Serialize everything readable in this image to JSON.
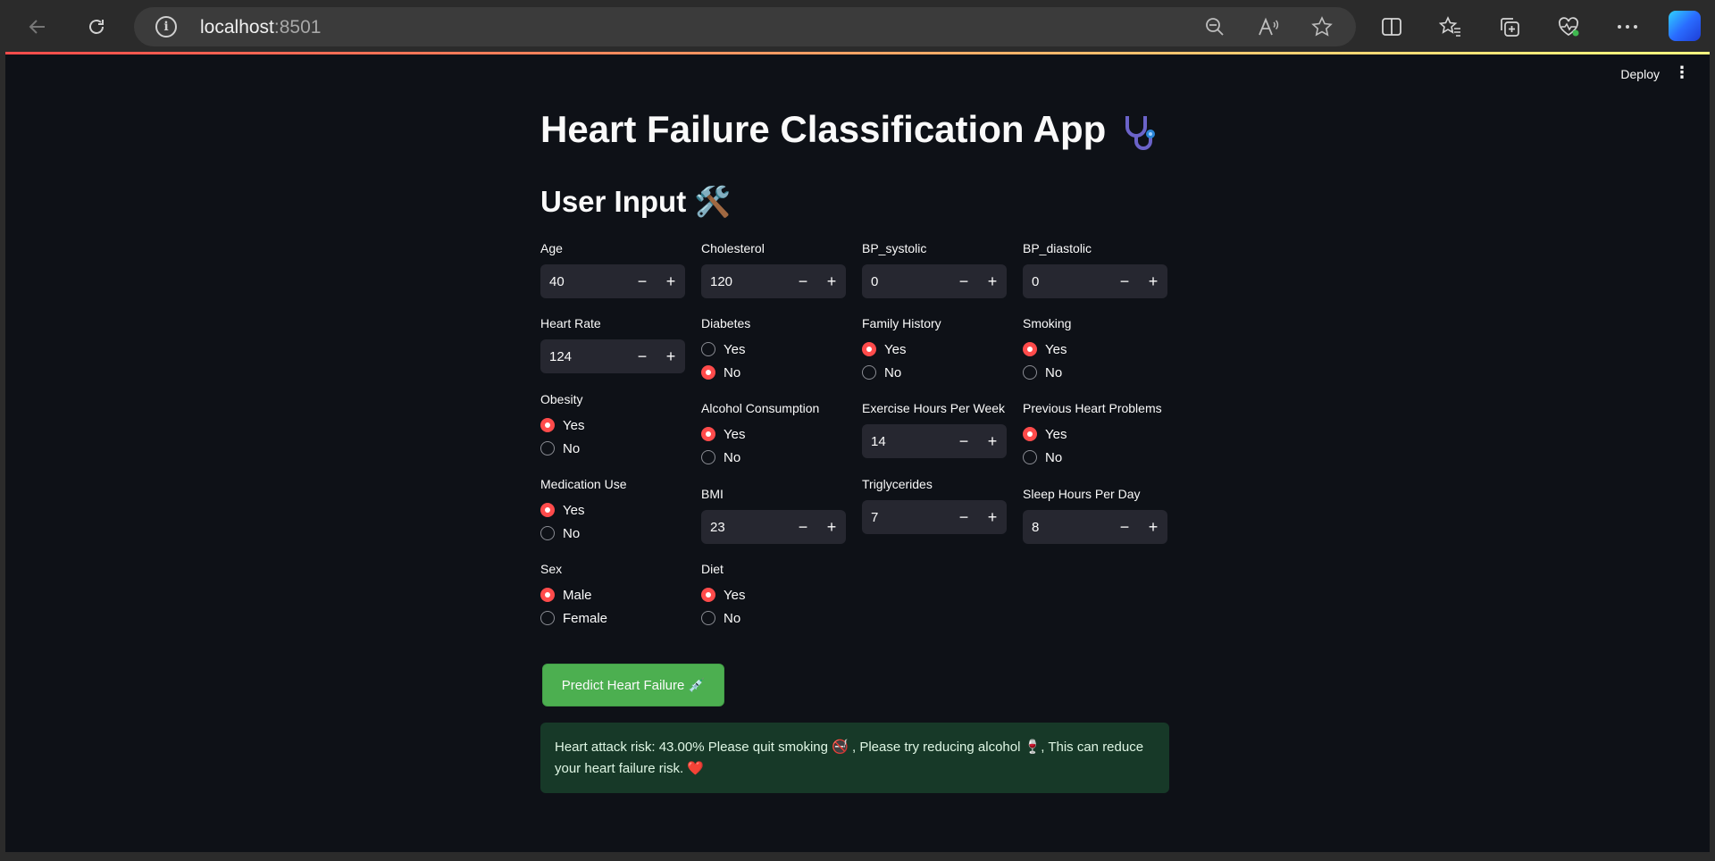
{
  "browser": {
    "url_host": "localhost",
    "url_port": ":8501"
  },
  "app": {
    "deploy_label": "Deploy",
    "title": "Heart Failure Classification App",
    "subtitle": "User Input 🛠️",
    "number_inputs": {
      "age": {
        "label": "Age",
        "value": "40"
      },
      "cholesterol": {
        "label": "Cholesterol",
        "value": "120"
      },
      "bp_systolic": {
        "label": "BP_systolic",
        "value": "0"
      },
      "bp_diastolic": {
        "label": "BP_diastolic",
        "value": "0"
      },
      "heart_rate": {
        "label": "Heart Rate",
        "value": "124"
      },
      "exercise": {
        "label": "Exercise Hours Per Week",
        "value": "14"
      },
      "bmi": {
        "label": "BMI",
        "value": "23"
      },
      "triglycerides": {
        "label": "Triglycerides",
        "value": "7"
      },
      "sleep": {
        "label": "Sleep Hours Per Day",
        "value": "8"
      }
    },
    "radios": {
      "diabetes": {
        "label": "Diabetes",
        "options": [
          "Yes",
          "No"
        ],
        "selected": "No"
      },
      "family_history": {
        "label": "Family History",
        "options": [
          "Yes",
          "No"
        ],
        "selected": "Yes"
      },
      "smoking": {
        "label": "Smoking",
        "options": [
          "Yes",
          "No"
        ],
        "selected": "Yes"
      },
      "obesity": {
        "label": "Obesity",
        "options": [
          "Yes",
          "No"
        ],
        "selected": "Yes"
      },
      "alcohol": {
        "label": "Alcohol Consumption",
        "options": [
          "Yes",
          "No"
        ],
        "selected": "Yes"
      },
      "prev_heart": {
        "label": "Previous Heart Problems",
        "options": [
          "Yes",
          "No"
        ],
        "selected": "Yes"
      },
      "medication": {
        "label": "Medication Use",
        "options": [
          "Yes",
          "No"
        ],
        "selected": "Yes"
      },
      "sex": {
        "label": "Sex",
        "options": [
          "Male",
          "Female"
        ],
        "selected": "Male"
      },
      "diet": {
        "label": "Diet",
        "options": [
          "Yes",
          "No"
        ],
        "selected": "Yes"
      }
    },
    "stepper_minus": "−",
    "stepper_plus": "+",
    "predict_button": "Predict Heart Failure 💉",
    "result_text": "Heart attack risk: 43.00% Please quit smoking 🚭 , Please try reducing alcohol 🍷, This can reduce your heart failure risk. ❤️"
  },
  "colors": {
    "accent": "#ff4b4b",
    "button_green": "#4caf50",
    "success_bg": "#173928",
    "background": "#0e1117"
  },
  "icons": [
    "back-arrow-icon",
    "refresh-icon",
    "info-icon",
    "zoom-out-icon",
    "read-aloud-icon",
    "favorite-star-icon",
    "split-screen-icon",
    "favorites-icon",
    "collections-icon",
    "browser-essentials-icon",
    "more-icon",
    "copilot-icon",
    "stethoscope-icon"
  ]
}
